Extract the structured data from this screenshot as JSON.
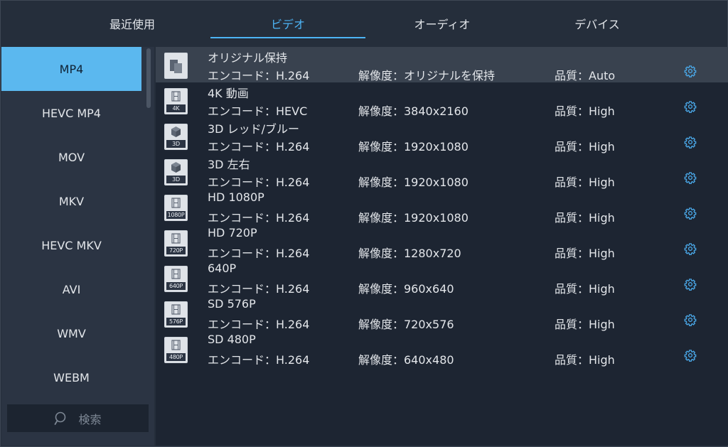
{
  "tabs": [
    {
      "label": "最近使用",
      "active": false
    },
    {
      "label": "ビデオ",
      "active": true
    },
    {
      "label": "オーディオ",
      "active": false
    },
    {
      "label": "デバイス",
      "active": false
    }
  ],
  "sidebar": {
    "items": [
      {
        "label": "MP4",
        "active": true
      },
      {
        "label": "HEVC MP4",
        "active": false
      },
      {
        "label": "MOV",
        "active": false
      },
      {
        "label": "MKV",
        "active": false
      },
      {
        "label": "HEVC MKV",
        "active": false
      },
      {
        "label": "AVI",
        "active": false
      },
      {
        "label": "WMV",
        "active": false
      },
      {
        "label": "WEBM",
        "active": false
      }
    ],
    "search_label": "検索",
    "search_icon": "search-icon"
  },
  "formats": [
    {
      "name": "オリジナル保持",
      "encode": "エンコード：H.264",
      "resolution": "解像度：オリジナルを保持",
      "quality": "品質：Auto",
      "icon": "original-icon",
      "tag": "",
      "active": true
    },
    {
      "name": "4K 動画",
      "encode": "エンコード：HEVC",
      "resolution": "解像度：3840x2160",
      "quality": "品質：High",
      "icon": "film-icon",
      "tag": "4K",
      "active": false
    },
    {
      "name": "3D レッド/ブルー",
      "encode": "エンコード：H.264",
      "resolution": "解像度：1920x1080",
      "quality": "品質：High",
      "icon": "cube-icon",
      "tag": "3D",
      "active": false
    },
    {
      "name": "3D 左右",
      "encode": "エンコード：H.264",
      "resolution": "解像度：1920x1080",
      "quality": "品質：High",
      "icon": "cube-icon",
      "tag": "3D",
      "active": false
    },
    {
      "name": "HD 1080P",
      "encode": "エンコード：H.264",
      "resolution": "解像度：1920x1080",
      "quality": "品質：High",
      "icon": "film-icon",
      "tag": "1080P",
      "active": false
    },
    {
      "name": "HD 720P",
      "encode": "エンコード：H.264",
      "resolution": "解像度：1280x720",
      "quality": "品質：High",
      "icon": "film-icon",
      "tag": "720P",
      "active": false
    },
    {
      "name": "640P",
      "encode": "エンコード：H.264",
      "resolution": "解像度：960x640",
      "quality": "品質：High",
      "icon": "film-icon",
      "tag": "640P",
      "active": false
    },
    {
      "name": "SD 576P",
      "encode": "エンコード：H.264",
      "resolution": "解像度：720x576",
      "quality": "品質：High",
      "icon": "film-icon",
      "tag": "576P",
      "active": false
    },
    {
      "name": "SD 480P",
      "encode": "エンコード：H.264",
      "resolution": "解像度：640x480",
      "quality": "品質：High",
      "icon": "film-icon",
      "tag": "480P",
      "active": false
    }
  ],
  "colors": {
    "accent": "#4db4f5",
    "active_sidebar": "#5bb8ef",
    "gear": "#4aa8e8"
  }
}
